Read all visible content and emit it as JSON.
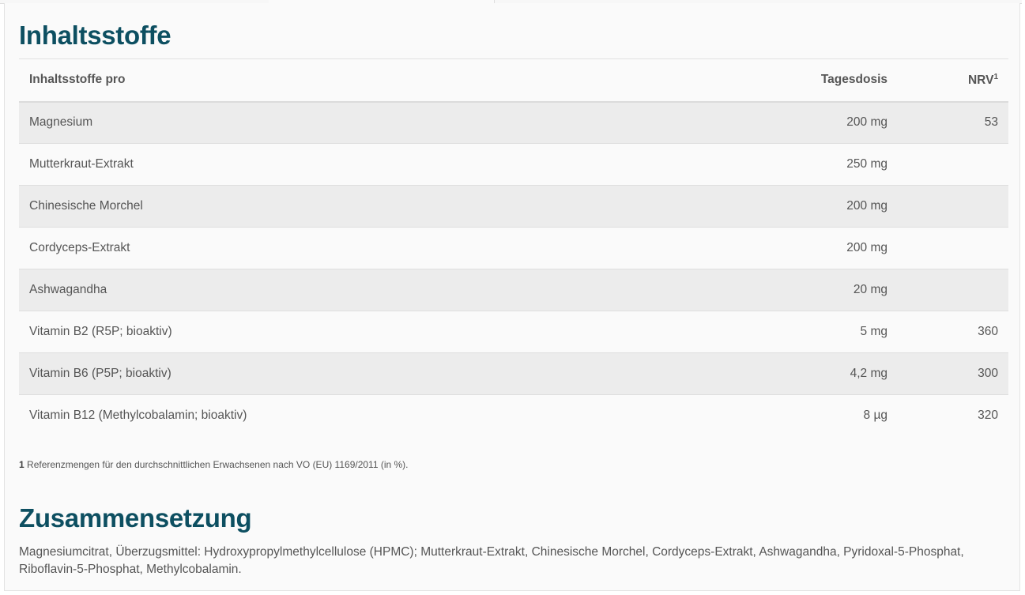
{
  "ingredients": {
    "title": "Inhaltsstoffe",
    "table": {
      "headers": {
        "name": "Inhaltsstoffe pro",
        "dose": "Tagesdosis",
        "nrv": "NRV",
        "nrv_sup": "1"
      },
      "rows": [
        {
          "name": "Magnesium",
          "dose": "200 mg",
          "nrv": "53"
        },
        {
          "name": "Mutterkraut-Extrakt",
          "dose": "250 mg",
          "nrv": ""
        },
        {
          "name": "Chinesische Morchel",
          "dose": "200 mg",
          "nrv": ""
        },
        {
          "name": "Cordyceps-Extrakt",
          "dose": "200 mg",
          "nrv": ""
        },
        {
          "name": "Ashwagandha",
          "dose": "20 mg",
          "nrv": ""
        },
        {
          "name": "Vitamin B2 (R5P; bioaktiv)",
          "dose": "5 mg",
          "nrv": "360"
        },
        {
          "name": "Vitamin B6 (P5P; bioaktiv)",
          "dose": "4,2 mg",
          "nrv": "300"
        },
        {
          "name": "Vitamin B12 (Methylcobalamin; bioaktiv)",
          "dose": "8 µg",
          "nrv": "320"
        }
      ]
    },
    "footnote": {
      "marker": "1",
      "text": " Referenzmengen für den durchschnittlichen Erwachsenen nach VO (EU) 1169/2011 (in %)."
    }
  },
  "composition": {
    "title": "Zusammensetzung",
    "text": "Magnesiumcitrat, Überzugsmittel: Hydroxypropylmethylcellulose (HPMC); Mutterkraut-Extrakt, Chinesische Morchel, Cordyceps-Extrakt, Ashwagandha, Pyridoxal-5-Phosphat, Riboflavin-5-Phosphat, Methylcobalamin."
  },
  "colors": {
    "heading": "#0d4f61",
    "text": "#555555",
    "row_alt": "#ececec",
    "panel": "#fafafa"
  }
}
